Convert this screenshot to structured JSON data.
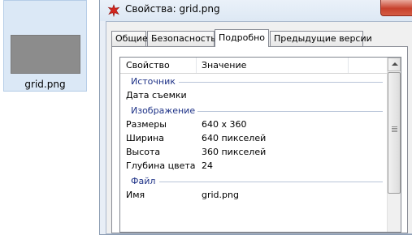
{
  "file": {
    "name": "grid.png"
  },
  "window": {
    "title": "Свойства: grid.png"
  },
  "tabs": [
    {
      "label": "Общие"
    },
    {
      "label": "Безопасность"
    },
    {
      "label": "Подробно"
    },
    {
      "label": "Предыдущие версии"
    }
  ],
  "active_tab": "Подробно",
  "list": {
    "headers": {
      "property": "Свойство",
      "value": "Значение"
    },
    "groups": [
      {
        "label": "Источник",
        "rows": [
          {
            "name": "Дата съемки",
            "value": ""
          }
        ]
      },
      {
        "label": "Изображение",
        "rows": [
          {
            "name": "Размеры",
            "value": "640 x 360"
          },
          {
            "name": "Ширина",
            "value": "640 пикселей"
          },
          {
            "name": "Высота",
            "value": "360 пикселей"
          },
          {
            "name": "Глубина цвета",
            "value": "24"
          }
        ]
      },
      {
        "label": "Файл",
        "rows": [
          {
            "name": "Имя",
            "value": "grid.png"
          }
        ]
      }
    ]
  },
  "colors": {
    "group_label": "#1e3287",
    "close_button": "#c7412c",
    "selection": "#dbe8f6"
  },
  "icons": {
    "app": "red-star-app-icon",
    "scroll_up": "chevron-up-icon"
  }
}
